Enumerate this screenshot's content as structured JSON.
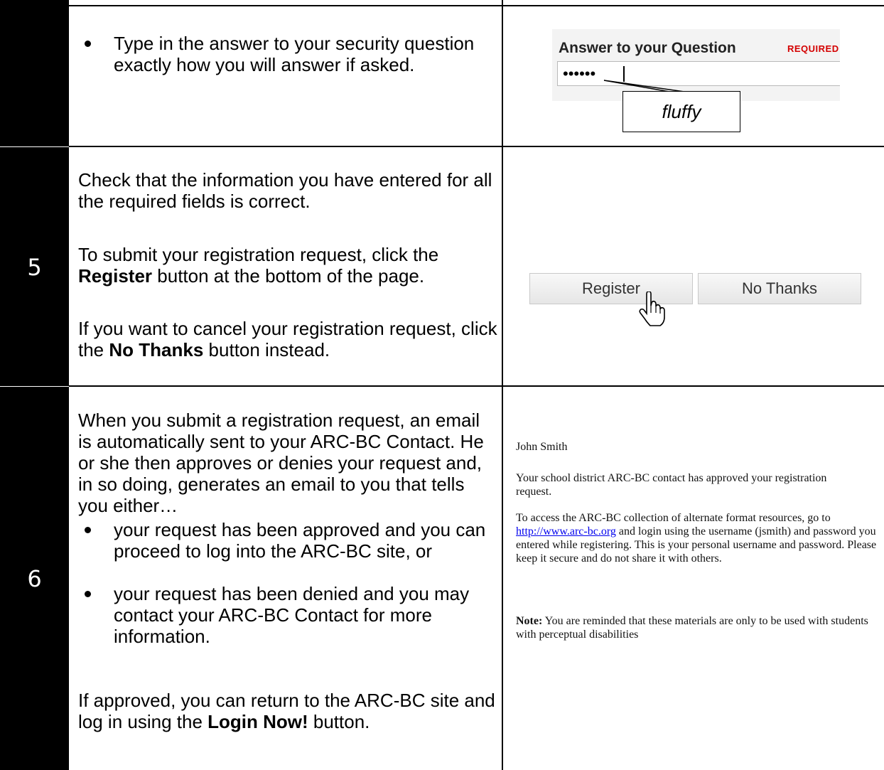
{
  "row4": {
    "bullet": "Type in the answer to your security question exactly how you will answer if asked.",
    "mock": {
      "label": "Answer to your Question",
      "required": "REQUIRED",
      "masked_value": "••••••",
      "callout": "fluffy"
    }
  },
  "row5": {
    "step": "5",
    "p1": "Check that the information you have entered for all the required fields is correct.",
    "p2_pre": "To submit your registration request, click the",
    "p2_bold": "Register",
    "p2_post": "button at the bottom of the page.",
    "p3_pre": "If you want to cancel your registration request, click the",
    "p3_bold": "No Thanks",
    "p3_post": "button instead.",
    "register_label": "Register",
    "nothanks_label": "No Thanks"
  },
  "row6": {
    "step": "6",
    "intro": "When you submit a registration request, an email is automatically sent to your ARC-BC Contact.  He or she then approves or denies your request and, in so doing, generates an email to you that tells you either…",
    "bullets": [
      "your request has been approved and you can proceed to log into the ARC-BC site, or",
      "your request has been denied and you may contact your ARC-BC Contact for more information."
    ],
    "outro_pre": "If approved, you can return to the ARC-BC site and log in using the",
    "outro_bold": "Login Now!",
    "outro_post": "button.",
    "email": {
      "name": "John Smith",
      "p1": "Your school district ARC-BC contact has approved your registration request.",
      "p2_pre": "To access the ARC-BC collection of alternate format resources, go to",
      "p2_link": "http://www.arc-bc.org",
      "p2_post": "and login using the username (jsmith) and password you entered while registering. This is your personal username and password. Please keep it secure and do not share it with others.",
      "note_label": "Note:",
      "note_text": "You are reminded that these materials are only to be used with students with perceptual disabilities"
    }
  }
}
